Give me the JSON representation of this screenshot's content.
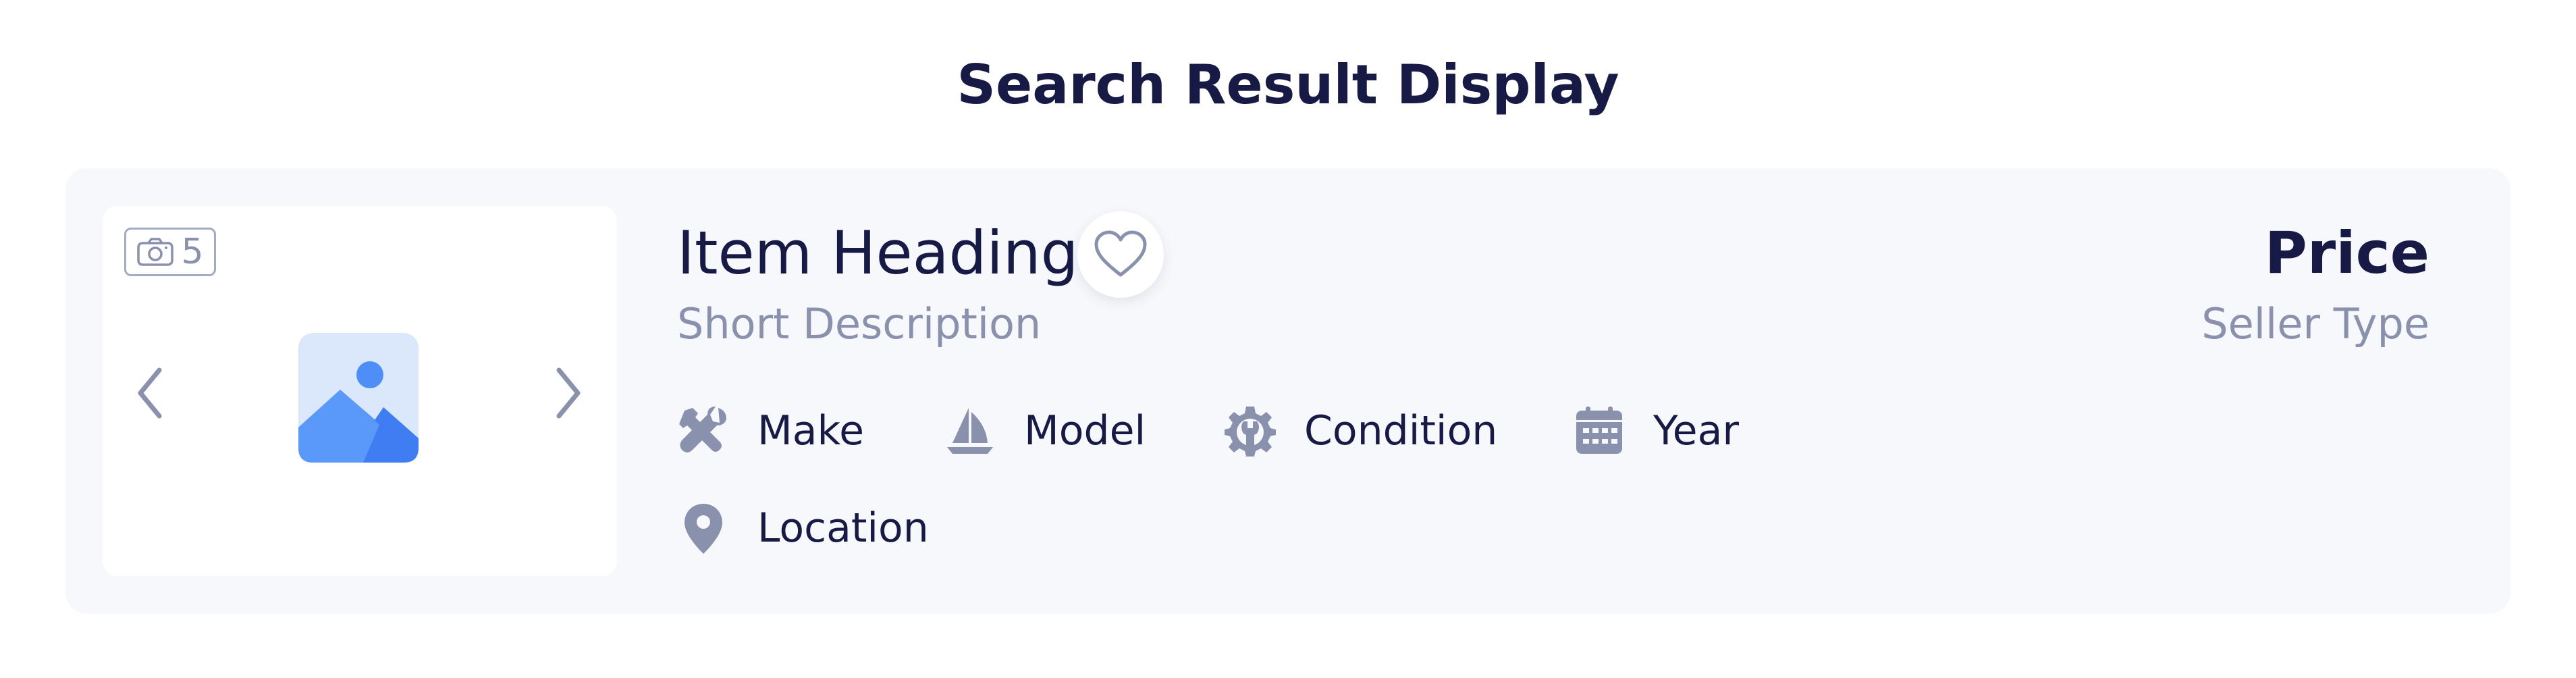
{
  "page": {
    "title": "Search Result Display"
  },
  "listing": {
    "photo_count": "5",
    "heading": "Item Heading",
    "short_description": "Short Description",
    "price": "Price",
    "seller_type": "Seller Type",
    "attributes": [
      {
        "label": "Make",
        "icon": "tools-icon"
      },
      {
        "label": "Model",
        "icon": "sailboat-icon"
      },
      {
        "label": "Condition",
        "icon": "gear-wrench-icon"
      },
      {
        "label": "Year",
        "icon": "calendar-icon"
      },
      {
        "label": "Location",
        "icon": "map-pin-icon"
      }
    ]
  },
  "colors": {
    "title": "#171a45",
    "muted": "#8a91ad",
    "card_bg": "#f7f8fc",
    "icon": "#8a91ad",
    "image_accent": "#4d8ff7"
  }
}
